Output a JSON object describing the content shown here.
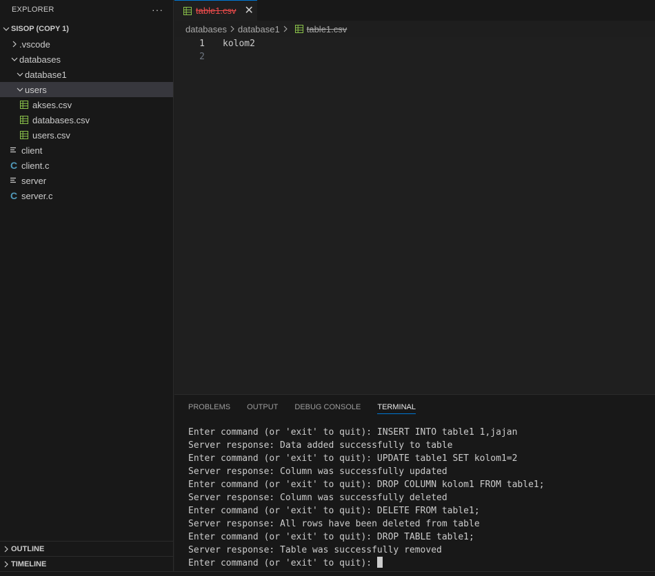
{
  "sidebar": {
    "title": "EXPLORER",
    "more": "···",
    "folder": "SISOP (COPY 1)",
    "items": [
      {
        "label": ".vscode"
      },
      {
        "label": "databases"
      },
      {
        "label": "database1"
      },
      {
        "label": "users"
      },
      {
        "label": "akses.csv"
      },
      {
        "label": "databases.csv"
      },
      {
        "label": "users.csv"
      },
      {
        "label": "client"
      },
      {
        "label": "client.c"
      },
      {
        "label": "server"
      },
      {
        "label": "server.c"
      }
    ],
    "c_icon": "C",
    "outline": "OUTLINE",
    "timeline": "TIMELINE"
  },
  "tabs": [
    {
      "label": "table1.csv",
      "close": "✕"
    }
  ],
  "breadcrumb": [
    "databases",
    "database1",
    "table1.csv"
  ],
  "editor": {
    "lines": [
      {
        "num": "1",
        "text": "kolom2"
      },
      {
        "num": "2",
        "text": ""
      }
    ]
  },
  "panel": {
    "tabs": [
      "PROBLEMS",
      "OUTPUT",
      "DEBUG CONSOLE",
      "TERMINAL"
    ],
    "terminal_lines": [
      "Enter command (or 'exit' to quit): INSERT INTO table1 1,jajan",
      "Server response: Data added successfully to table",
      "Enter command (or 'exit' to quit): UPDATE table1 SET kolom1=2",
      "Server response: Column was successfully updated",
      "Enter command (or 'exit' to quit): DROP COLUMN kolom1 FROM table1;",
      "Server response: Column was successfully deleted",
      "Enter command (or 'exit' to quit): DELETE FROM table1;",
      "Server response: All rows have been deleted from table",
      "Enter command (or 'exit' to quit): DROP TABLE table1;",
      "Server response: Table was successfully removed",
      "Enter command (or 'exit' to quit): "
    ]
  },
  "colors": {
    "csv_icon": "#8bc34a",
    "c_icon": "#519aba",
    "deleted_tab": "#f14c4c",
    "accent": "#0078d4"
  }
}
